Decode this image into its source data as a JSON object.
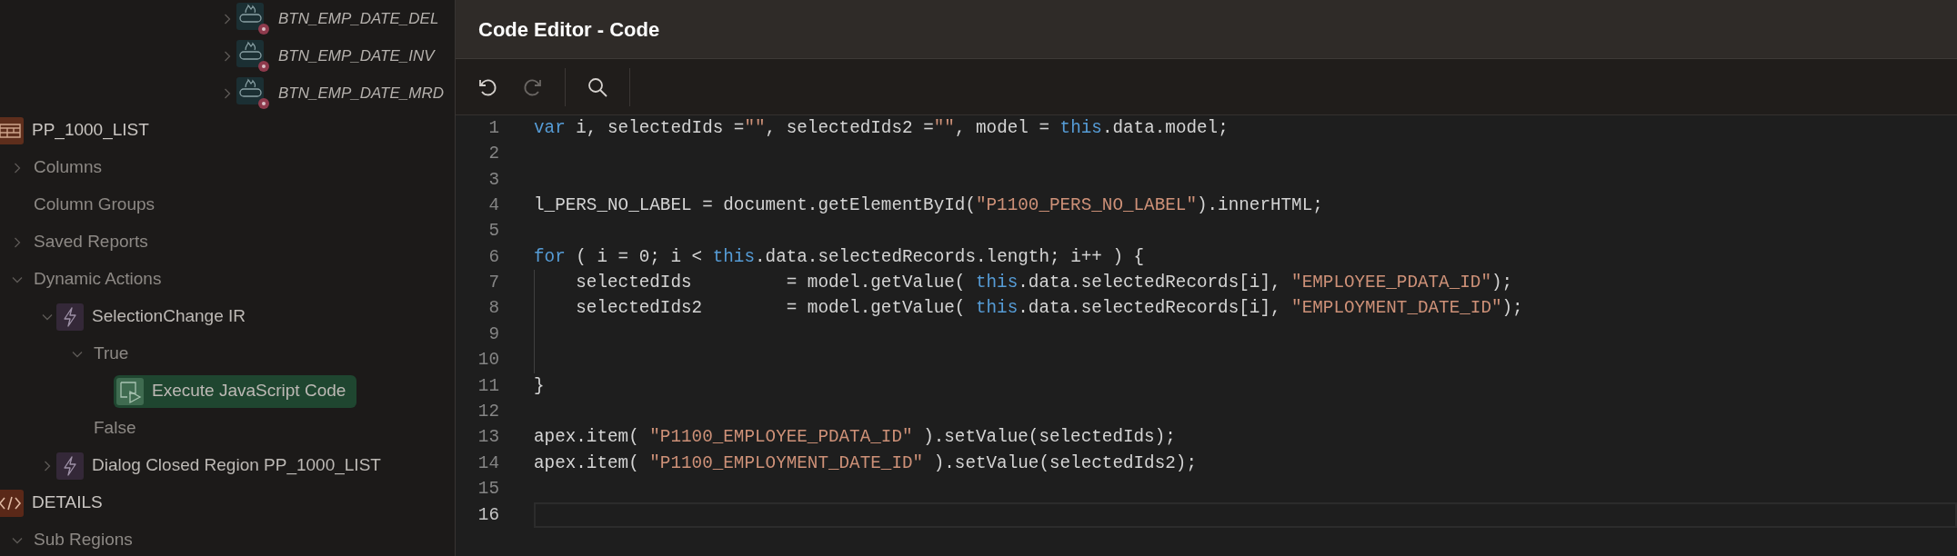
{
  "tree": {
    "continued_items": [
      {
        "label": "BTN_EMP_DATE_DEL",
        "kind": "button",
        "expanded": false,
        "selected": false
      },
      {
        "label": "BTN_EMP_DATE_INV",
        "kind": "button",
        "expanded": false,
        "selected": false
      },
      {
        "label": "BTN_EMP_DATE_MRD",
        "kind": "button",
        "expanded": false,
        "selected": false
      }
    ],
    "items": [
      {
        "label": "PP_1000_LIST",
        "kind": "region",
        "selected": false,
        "children": [
          {
            "label": "Columns",
            "kind": "folder",
            "expanded": false,
            "selected": false
          },
          {
            "label": "Column Groups",
            "kind": "folder",
            "selected": false
          },
          {
            "label": "Saved Reports",
            "kind": "folder",
            "expanded": false,
            "selected": false
          },
          {
            "label": "Dynamic Actions",
            "kind": "folder",
            "expanded": true,
            "selected": false,
            "children": [
              {
                "label": "SelectionChange IR",
                "kind": "dynamic_action",
                "expanded": true,
                "selected": false,
                "children": [
                  {
                    "label": "True",
                    "kind": "folder",
                    "expanded": true,
                    "selected": false,
                    "children": [
                      {
                        "label": "Execute JavaScript Code",
                        "kind": "js_action",
                        "selected": true
                      }
                    ]
                  },
                  {
                    "label": "False",
                    "kind": "folder",
                    "selected": false
                  }
                ]
              },
              {
                "label": "Dialog Closed Region PP_1000_LIST",
                "kind": "dynamic_action",
                "expanded": false,
                "selected": false
              }
            ]
          }
        ]
      },
      {
        "label": "DETAILS",
        "kind": "source",
        "selected": false,
        "children": [
          {
            "label": "Sub Regions",
            "kind": "folder",
            "expanded": true,
            "selected": false
          }
        ]
      }
    ]
  },
  "editor": {
    "title": "Code Editor - Code",
    "toolbar": [
      {
        "kind": "undo",
        "disabled": false
      },
      {
        "kind": "redo",
        "disabled": true
      },
      {
        "kind": "search",
        "disabled": false
      }
    ],
    "lines": [
      {
        "number": "1",
        "tokens": [
          {
            "kind": "keyword",
            "text": "var"
          },
          {
            "kind": "plain",
            "text": " i, selectedIds ="
          },
          {
            "kind": "string",
            "text": "\"\""
          },
          {
            "kind": "plain",
            "text": ", selectedIds2 ="
          },
          {
            "kind": "string",
            "text": "\"\""
          },
          {
            "kind": "plain",
            "text": ", model = "
          },
          {
            "kind": "keyword",
            "text": "this"
          },
          {
            "kind": "plain",
            "text": ".data.model;"
          }
        ]
      },
      {
        "number": "2"
      },
      {
        "number": "3"
      },
      {
        "number": "4",
        "tokens": [
          {
            "kind": "plain",
            "text": "l_PERS_NO_LABEL = document.getElementById("
          },
          {
            "kind": "string",
            "text": "\"P1100_PERS_NO_LABEL\""
          },
          {
            "kind": "plain",
            "text": ").innerHTML;"
          }
        ]
      },
      {
        "number": "5"
      },
      {
        "number": "6",
        "tokens": [
          {
            "kind": "keyword",
            "text": "for"
          },
          {
            "kind": "plain",
            "text": " ( i = 0; i < "
          },
          {
            "kind": "keyword",
            "text": "this"
          },
          {
            "kind": "plain",
            "text": ".data.selectedRecords.length; i++ ) {"
          }
        ]
      },
      {
        "number": "7",
        "guide": true,
        "tokens": [
          {
            "kind": "plain",
            "text": "    selectedIds         = model.getValue( "
          },
          {
            "kind": "keyword",
            "text": "this"
          },
          {
            "kind": "plain",
            "text": ".data.selectedRecords[i], "
          },
          {
            "kind": "string",
            "text": "\"EMPLOYEE_PDATA_ID\""
          },
          {
            "kind": "plain",
            "text": ");"
          }
        ]
      },
      {
        "number": "8",
        "guide": true,
        "tokens": [
          {
            "kind": "plain",
            "text": "    selectedIds2        = model.getValue( "
          },
          {
            "kind": "keyword",
            "text": "this"
          },
          {
            "kind": "plain",
            "text": ".data.selectedRecords[i], "
          },
          {
            "kind": "string",
            "text": "\"EMPLOYMENT_DATE_ID\""
          },
          {
            "kind": "plain",
            "text": ");"
          }
        ]
      },
      {
        "number": "9",
        "guide": true
      },
      {
        "number": "10",
        "guide": true
      },
      {
        "number": "11",
        "tokens": [
          {
            "kind": "plain",
            "text": "}"
          }
        ]
      },
      {
        "number": "12"
      },
      {
        "number": "13",
        "tokens": [
          {
            "kind": "plain",
            "text": "apex.item( "
          },
          {
            "kind": "string",
            "text": "\"P1100_EMPLOYEE_PDATA_ID\""
          },
          {
            "kind": "plain",
            "text": " ).setValue(selectedIds);"
          }
        ]
      },
      {
        "number": "14",
        "tokens": [
          {
            "kind": "plain",
            "text": "apex.item( "
          },
          {
            "kind": "string",
            "text": "\"P1100_EMPLOYMENT_DATE_ID\""
          },
          {
            "kind": "plain",
            "text": " ).setValue(selectedIds2);"
          }
        ]
      },
      {
        "number": "15"
      },
      {
        "number": "16",
        "current": true
      }
    ]
  }
}
